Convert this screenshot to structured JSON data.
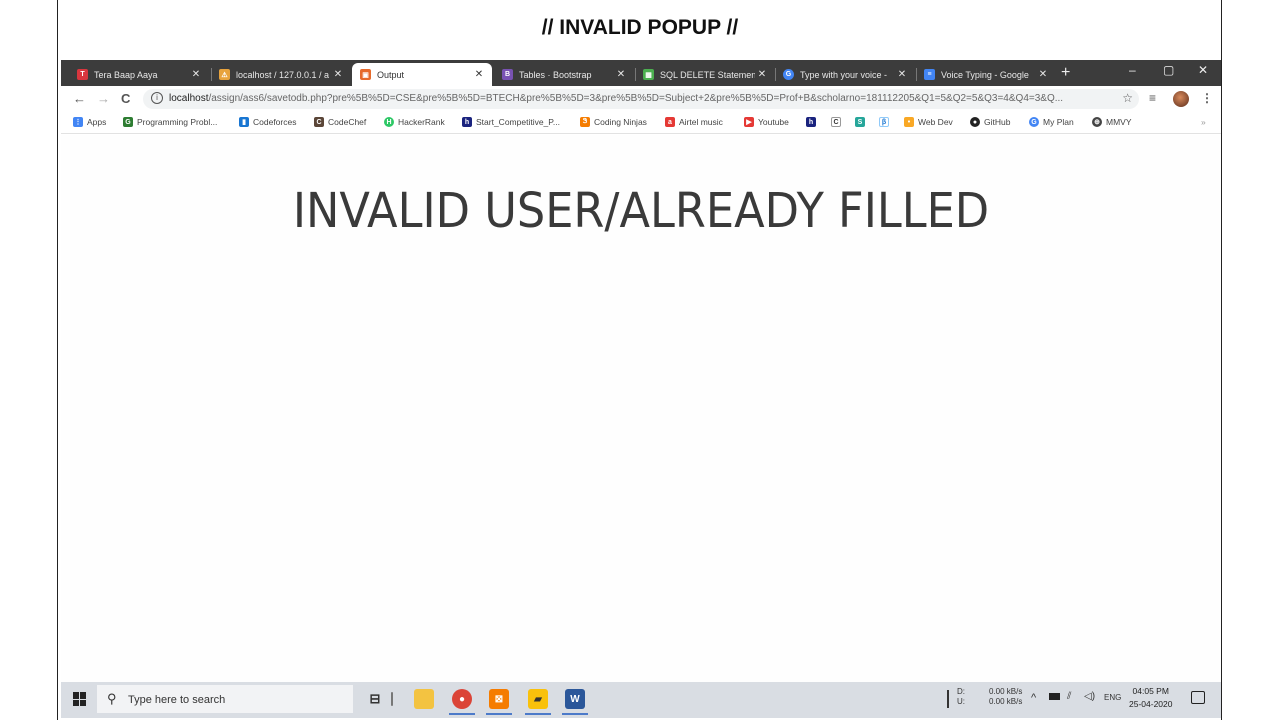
{
  "slide": {
    "title": "// INVALID POPUP //"
  },
  "tabs": [
    {
      "label": "Tera Baap Aaya",
      "color": "#d9363e",
      "icon": "T"
    },
    {
      "label": "localhost / 127.0.0.1 / a",
      "color": "#e8a33d",
      "icon": "⚠"
    },
    {
      "label": "Output",
      "color": "#e66a2c",
      "icon": "▣"
    },
    {
      "label": "Tables · Bootstrap",
      "color": "#7952b3",
      "icon": "B"
    },
    {
      "label": "SQL DELETE Statement",
      "color": "#4caf50",
      "icon": "▦"
    },
    {
      "label": "Type with your voice -",
      "color": "#4285f4",
      "icon": "G"
    },
    {
      "label": "Voice Typing - Google",
      "color": "#4285f4",
      "icon": "≡"
    }
  ],
  "tab_close": "✕",
  "new_tab": "+",
  "window": {
    "minimize": "–",
    "maximize": "▢",
    "close": "✕"
  },
  "toolbar": {
    "back": "←",
    "forward": "→",
    "reload": "C",
    "url_host": "localhost",
    "url_path": "/assign/ass6/savetodb.php?pre%5B%5D=CSE&pre%5B%5D=BTECH&pre%5B%5D=3&pre%5B%5D=Subject+2&pre%5B%5D=Prof+B&scholarno=181112205&Q1=5&Q2=5&Q3=4&Q4=3&Q...",
    "star": "☆",
    "reading": "≡",
    "menu": "⋮"
  },
  "bookmarks": [
    {
      "label": "Apps",
      "color": "#4285f4",
      "icon": "⋮"
    },
    {
      "label": "Programming Probl...",
      "color": "#2e7d32",
      "icon": "G"
    },
    {
      "label": "Codeforces",
      "color": "#1976d2",
      "icon": "▮"
    },
    {
      "label": "CodeChef",
      "color": "#5b4638",
      "icon": "C"
    },
    {
      "label": "HackerRank",
      "color": "#2ec866",
      "icon": "H"
    },
    {
      "label": "Start_Competitive_P...",
      "color": "#1a237e",
      "icon": "h"
    },
    {
      "label": "Coding Ninjas",
      "color": "#f57c00",
      "icon": "Ꮥ"
    },
    {
      "label": "Airtel music",
      "color": "#e53935",
      "icon": "a"
    },
    {
      "label": "Youtube",
      "color": "#e53935",
      "icon": "▶"
    },
    {
      "label": "Web Dev",
      "color": "#f9a825",
      "icon": "•"
    },
    {
      "label": "GitHub",
      "color": "#222222",
      "icon": "●"
    },
    {
      "label": "My Plan",
      "color": "#4285f4",
      "icon": "G"
    },
    {
      "label": "MMVY",
      "color": "#444444",
      "icon": "⊕"
    }
  ],
  "bookmarks_overflow": "»",
  "page": {
    "message": "INVALID USER/ALREADY FILLED"
  },
  "taskbar": {
    "search_placeholder": "Type here to search",
    "search_icon": "⚲",
    "task_view": "⊟",
    "net_d_label": "D:",
    "net_u_label": "U:",
    "net_d": "0.00 kB/s",
    "net_u": "0.00 kB/s",
    "tray_chevron": "^",
    "lang": "ENG",
    "time": "04:05 PM",
    "date": "25-04-2020"
  }
}
